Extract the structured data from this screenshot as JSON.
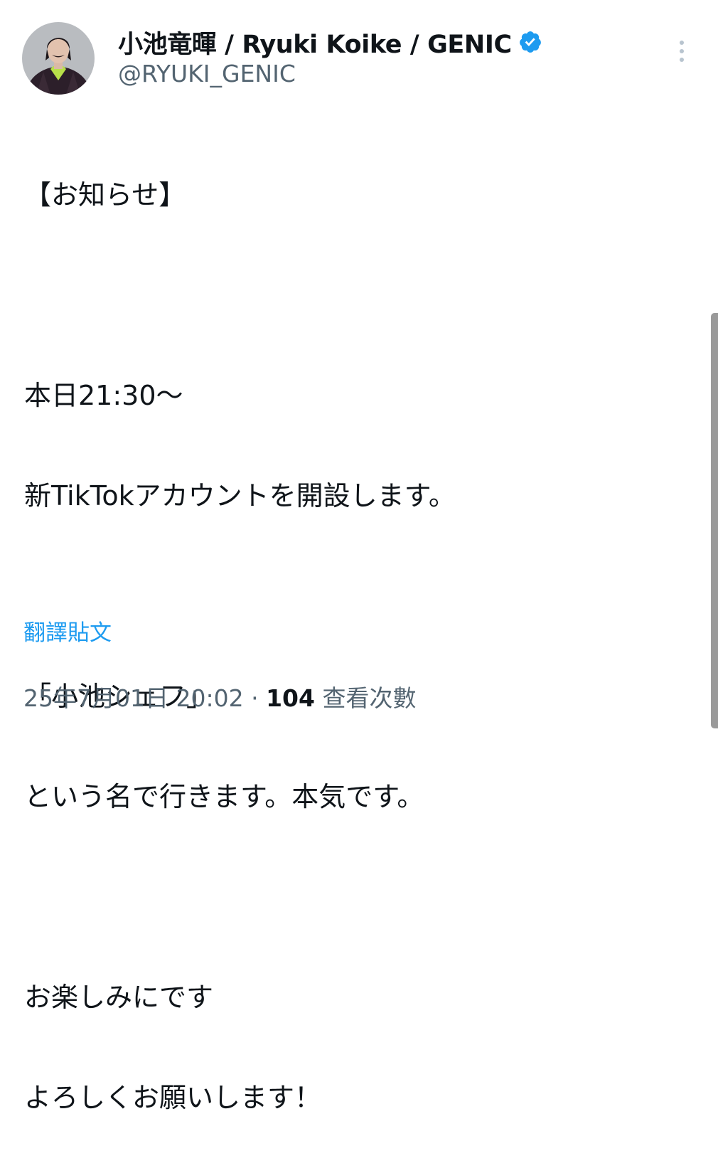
{
  "author": {
    "display_name": "小池竜暉 / Ryuki Koike / GENIC",
    "handle": "@RYUKI_GENIC",
    "verified": true
  },
  "tweet": {
    "lines": [
      "【お知らせ】",
      "",
      "本日21:30～",
      "新TikTokアカウントを開設します。",
      "",
      "「小池シェフ」",
      "という名で行きます。本気です。",
      "",
      "お楽しみにです",
      "よろしくお願いします！"
    ],
    "translate_label": "翻譯貼文"
  },
  "meta": {
    "timestamp": "25年7月01日 20:02",
    "separator": " · ",
    "views_count": "104",
    "views_label": " 查看次數"
  },
  "icons": {
    "verified": "verified-badge-icon",
    "more": "more-vertical-icon"
  },
  "colors": {
    "accent": "#1d9bf0",
    "text": "#0f1419",
    "secondary": "#536471"
  }
}
